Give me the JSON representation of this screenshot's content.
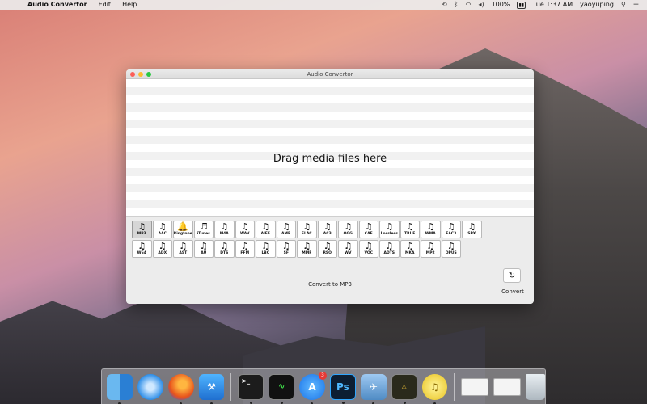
{
  "menubar": {
    "app_name": "Audio Convertor",
    "menus": [
      "Edit",
      "Help"
    ],
    "battery": "100%",
    "time": "Tue 1:37 AM",
    "user": "yaoyuping"
  },
  "window": {
    "title": "Audio Convertor",
    "drop_text": "Drag media files here",
    "status_text": "Convert to MP3",
    "convert_label": "Convert",
    "selected_format": "MP3",
    "formats_row1": [
      "MP3",
      "AAC",
      "Ringtone",
      "iTunes",
      "M4A",
      "WAV",
      "AIFF",
      "AMR",
      "FLAC",
      "AC3",
      "OGG",
      "CAF",
      "Lossless",
      "TRUE",
      "WMA",
      "EAC3",
      "SPX"
    ],
    "formats_row2": [
      "W64",
      "ADX",
      "AST",
      "AU",
      "DTS",
      "FFM",
      "LBC",
      "SF",
      "MMF",
      "RSO",
      "WV",
      "VOC",
      "ADTS",
      "MKA",
      "MP2",
      "OPUS"
    ]
  },
  "dock": {
    "badge_count": "3",
    "items": [
      "finder-icon",
      "safari-icon",
      "firefox-icon",
      "xcode-icon",
      "terminal-icon",
      "activity-monitor-icon",
      "app-store-icon",
      "photoshop-icon",
      "preview-icon",
      "console-icon",
      "audio-convertor-icon"
    ]
  }
}
